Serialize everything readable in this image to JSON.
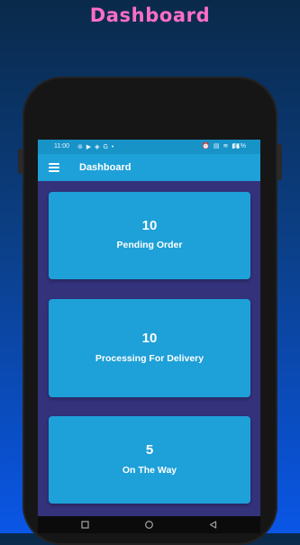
{
  "promo": {
    "title": "Dashboard"
  },
  "status_bar": {
    "time": "11:00",
    "left_icons": "⊚ ▶ ◈ G •",
    "right_icons": "⏰ ▤ ≋ ▮▮",
    "battery": "51%"
  },
  "app_bar": {
    "title": "Dashboard"
  },
  "cards": [
    {
      "value": "10",
      "label": "Pending Order"
    },
    {
      "value": "10",
      "label": "Processing For Delivery"
    },
    {
      "value": "5",
      "label": "On The Way"
    }
  ],
  "nav_bar": {
    "recent_icon": "square-icon",
    "home_icon": "circle-icon",
    "back_icon": "triangle-icon"
  },
  "colors": {
    "accent": "#1ea0d8",
    "screen_bg": "#34327a",
    "promo_title": "#ff6ec7"
  }
}
